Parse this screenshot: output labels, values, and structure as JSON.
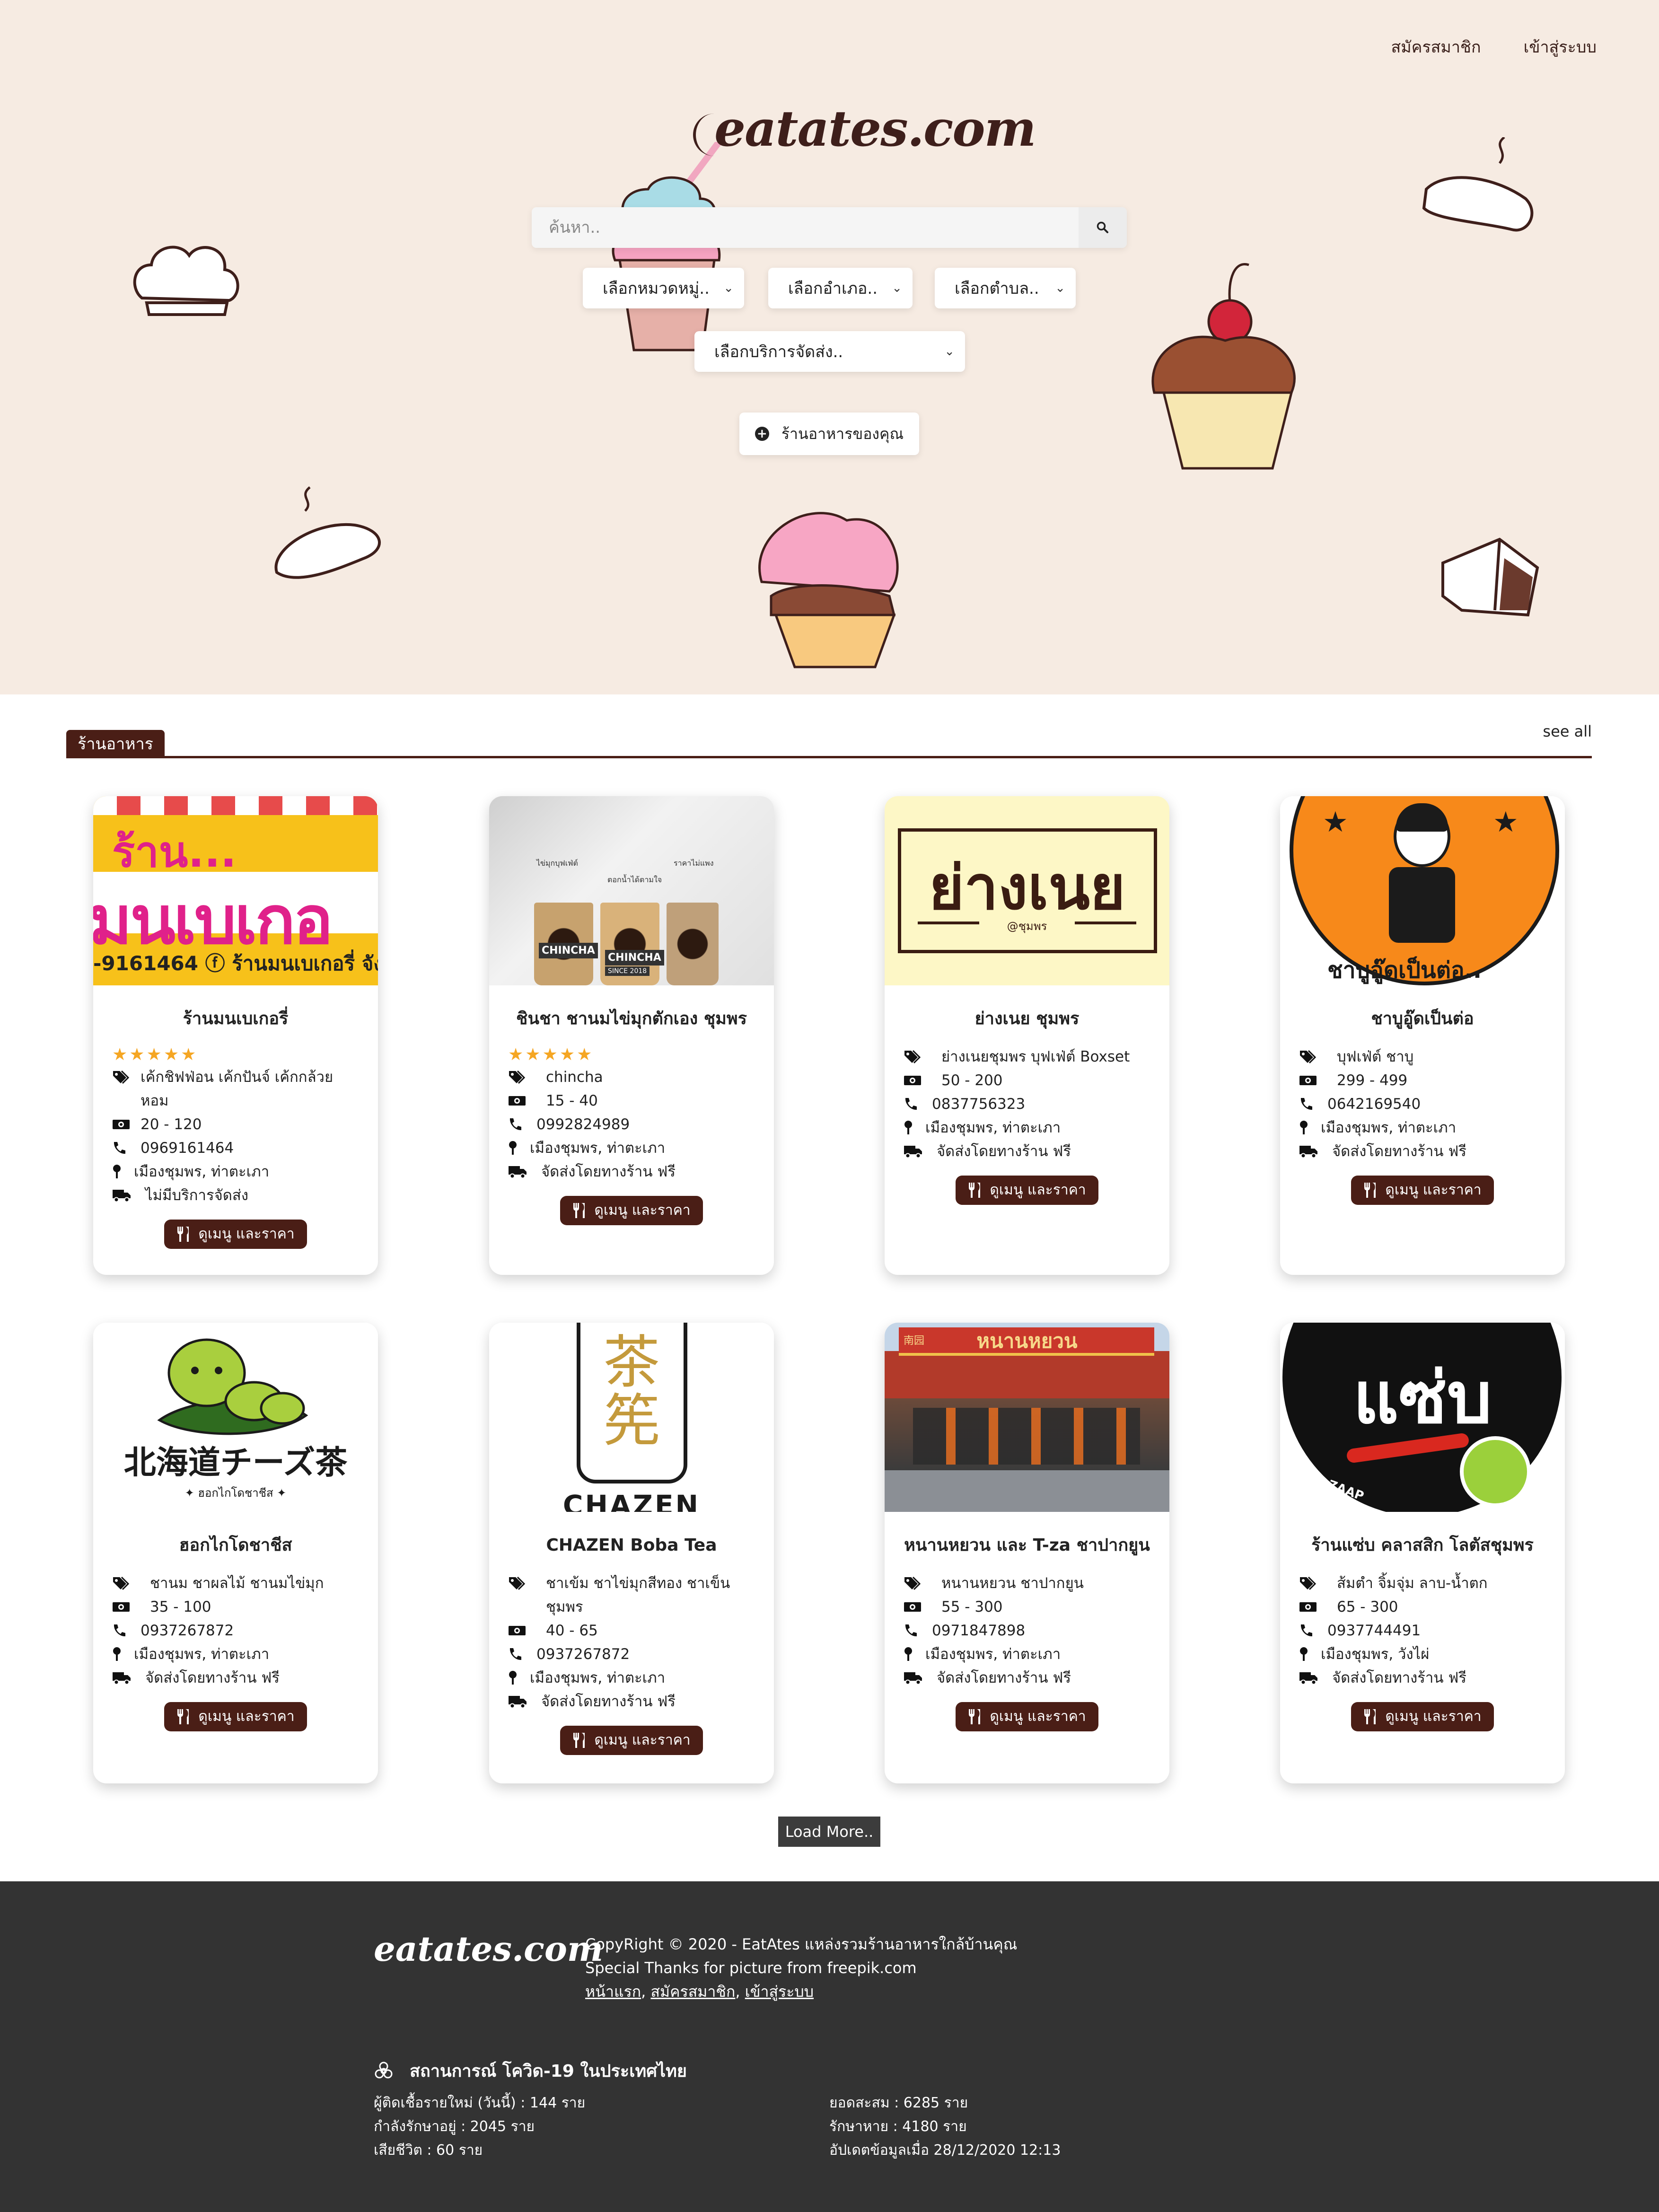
{
  "nav": {
    "register": "สมัครสมาชิก",
    "login": "เข้าสู่ระบบ"
  },
  "brand": {
    "logo": "eatates.com"
  },
  "search": {
    "placeholder": "ค้นหา.."
  },
  "filters": {
    "category": "เลือกหมวดหมู่..",
    "district": "เลือกอำเภอ..",
    "subdistrict": "เลือกตำบล..",
    "delivery": "เลือกบริการจัดส่ง.."
  },
  "add_shop_label": "ร้านอาหารของคุณ",
  "section": {
    "title": "ร้านอาหาร",
    "see_all": "see all"
  },
  "menu_button_label": "ดูเมนู และราคา",
  "load_more": "Load More..",
  "shops": [
    {
      "name": "ร้านมนเบเกอรี่",
      "stars": "★★★★★",
      "tags": "เค้กชิฟฟ่อน เค้กปันจ์ เค้กกล้วยหอม",
      "price": "20 - 120",
      "phone": "0969161464",
      "location": "เมืองชุมพร, ท่าตะเภา",
      "delivery": "ไม่มีบริการจัดส่ง"
    },
    {
      "name": "ชินชา ชานมไข่มุกตักเอง ชุมพร",
      "stars": "★★★★★",
      "tags": "chincha",
      "price": "15 - 40",
      "phone": "0992824989",
      "location": "เมืองชุมพร, ท่าตะเภา",
      "delivery": "จัดส่งโดยทางร้าน ฟรี"
    },
    {
      "name": "ย่างเนย ชุมพร",
      "tags": "ย่างเนยชุมพร บุฟเฟ่ต์ Boxset",
      "price": "50 - 200",
      "phone": "0837756323",
      "location": "เมืองชุมพร, ท่าตะเภา",
      "delivery": "จัดส่งโดยทางร้าน ฟรี"
    },
    {
      "name": "ชาบูอู๊ดเป็นต่อ",
      "tags": "บุฟเฟ่ต์ ชาบู",
      "price": "299 - 499",
      "phone": "0642169540",
      "location": "เมืองชุมพร, ท่าตะเภา",
      "delivery": "จัดส่งโดยทางร้าน ฟรี"
    },
    {
      "name": "ฮอกไกโดชาชีส",
      "tags": "ชานม ชาผลไม้ ชานมไข่มุก",
      "price": "35 - 100",
      "phone": "0937267872",
      "location": "เมืองชุมพร, ท่าตะเภา",
      "delivery": "จัดส่งโดยทางร้าน ฟรี"
    },
    {
      "name": "CHAZEN Boba Tea",
      "tags": "ชาเข้ม ชาไข่มุกสีทอง ชาเข็นชุมพร",
      "price": "40 - 65",
      "phone": "0937267872",
      "location": "เมืองชุมพร, ท่าตะเภา",
      "delivery": "จัดส่งโดยทางร้าน ฟรี"
    },
    {
      "name": "หนานหยวน และ T-za ชาปากยูน",
      "tags": "หนานหยวน ชาปากยูน",
      "price": "55 - 300",
      "phone": "0971847898",
      "location": "เมืองชุมพร, ท่าตะเภา",
      "delivery": "จัดส่งโดยทางร้าน ฟรี"
    },
    {
      "name": "ร้านแซ่บ คลาสสิก โลตัสชุมพร",
      "tags": "ส้มตำ จิ้มจุ่ม ลาบ-น้ำตก",
      "price": "65 - 300",
      "phone": "0937744491",
      "location": "เมืองชุมพร, วังไผ่",
      "delivery": "จัดส่งโดยทางร้าน ฟรี"
    }
  ],
  "images": {
    "mon_top": "ร้าน...",
    "mon_mid": "มนเบเกอ",
    "mon_bottom": "-9161464  ⓕ ร้านมนเบเกอรี่ จัง",
    "chincha_label": "CHINCHA",
    "chincha_sub": "SINCE 2018",
    "chincha_note1": "ไข่มุกบุฟเฟ่ต์",
    "chincha_note2": "ตอกน้ำได้ตามใจ",
    "chincha_note3": "ราคาไม่แพง",
    "yangnoey_title": "ย่างเนย",
    "yangnoey_sub": "@ชุมพร",
    "shabu_text": "ชาบูอู๊ดเป็นต่อ..",
    "hokkaido_jp": "北海道チーズ茶",
    "hokkaido_th": "✦ ฮอกไกโดชาชีส ✦",
    "chazen_c1": "茶",
    "chazen_c2": "筅",
    "chazen_word": "CHAZEN",
    "nanyuan_sign": "หนานหยวน",
    "nanyuan_small": "南园",
    "zaap_big": "แซ่บ",
    "zaap_ring": "ZAAP"
  },
  "footer": {
    "logo": "eatates.com",
    "copyright": "CopyRight © 2020 - EatAtes แหล่งรวมร้านอาหารใกล้บ้านคุณ",
    "thanks": "Special Thanks for picture from freepik.com",
    "link_home": "หน้าแรก",
    "link_register": "สมัครสมาชิก",
    "link_login": "เข้าสู่ระบบ",
    "covid_title": "สถานการณ์ โควิด-19 ในประเทศไทย",
    "new_cases": "ผู้ติดเชื้อรายใหม่ (วันนี้) : 144 ราย",
    "hospitalized": "กำลังรักษาอยู่ : 2045 ราย",
    "deaths": "เสียชีวิต : 60 ราย",
    "total": "ยอดสะสม : 6285 ราย",
    "recovered": "รักษาหาย : 4180 ราย",
    "updated": "อัปเดตข้อมูลเมื่อ 28/12/2020 12:13"
  },
  "colors": {
    "brown": "#4a1e16",
    "hero_bg": "#f6ebe2",
    "footer_bg": "#333333",
    "star": "#f5a623"
  },
  "icons": [
    "search-icon",
    "plus-circle-icon",
    "tag-icon",
    "money-icon",
    "phone-icon",
    "map-pin-icon",
    "truck-icon",
    "utensils-icon",
    "biohazard-icon",
    "chevron-down-icon"
  ]
}
